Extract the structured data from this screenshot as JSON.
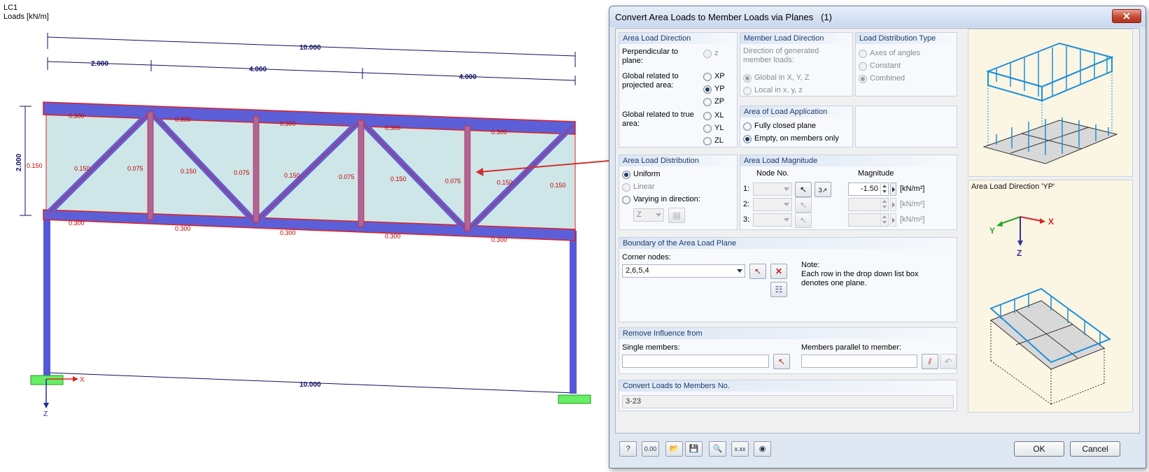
{
  "model": {
    "lc": "LC1",
    "units": "Loads [kN/m]",
    "dims": {
      "total_top": "10.000",
      "seg1": "2.000",
      "seg2": "4.000",
      "seg3": "4.000",
      "height": "2.000",
      "total_bottom": "10.000"
    },
    "load_values": {
      "chord": "0.300",
      "diag": "0.150",
      "post": "0.075"
    },
    "axes": {
      "x": "X",
      "z": "Z"
    }
  },
  "dialog": {
    "title": "Convert Area Loads to Member Loads via Planes",
    "title_count": "(1)",
    "close_label": "✕",
    "area_load_direction": {
      "title": "Area Load Direction",
      "perp_label": "Perpendicular to plane:",
      "perp_option": "z",
      "projected_label": "Global related to projected area:",
      "projected_options": [
        "XP",
        "YP",
        "ZP"
      ],
      "true_label": "Global related to true area:",
      "true_options": [
        "XL",
        "YL",
        "ZL"
      ]
    },
    "member_load_direction": {
      "title": "Member Load Direction",
      "desc": "Direction of generated member loads:",
      "options": [
        "Global in X, Y, Z",
        "Local in x, y, z"
      ]
    },
    "load_distribution_type": {
      "title": "Load Distribution Type",
      "options": [
        "Axes of angles",
        "Constant",
        "Combined"
      ]
    },
    "area_of_load_application": {
      "title": "Area of Load Application",
      "options": [
        "Fully closed plane",
        "Empty, on members only"
      ]
    },
    "area_load_distribution": {
      "title": "Area Load Distribution",
      "options": [
        "Uniform",
        "Linear",
        "Varying in direction:"
      ],
      "direction_value": "Z"
    },
    "area_load_magnitude": {
      "title": "Area Load Magnitude",
      "col_node": "Node No.",
      "col_magnitude": "Magnitude",
      "rows": [
        {
          "label": "1:",
          "magnitude": "-1.50",
          "unit": "[kN/m²]"
        },
        {
          "label": "2:",
          "magnitude": "",
          "unit": "[kN/m²]"
        },
        {
          "label": "3:",
          "magnitude": "",
          "unit": "[kN/m²]"
        }
      ]
    },
    "boundary": {
      "title": "Boundary of the Area Load Plane",
      "corner_label": "Corner nodes:",
      "corner_value": "2,6,5,4",
      "note_title": "Note:",
      "note_text_1": "Each row in the drop down list box",
      "note_text_2": "denotes one plane."
    },
    "remove_influence": {
      "title": "Remove Influence from",
      "single_label": "Single members:",
      "single_value": "",
      "parallel_label": "Members parallel to member:",
      "parallel_value": ""
    },
    "convert_loads": {
      "title": "Convert Loads to Members No.",
      "value": "3-23"
    },
    "preview_caption": "Area Load Direction 'YP'",
    "preview_axes": {
      "x": "X",
      "y": "Y",
      "z": "Z"
    },
    "buttons": {
      "ok": "OK",
      "cancel": "Cancel"
    },
    "footer_icons": [
      "help-icon",
      "units-icon",
      "open-icon",
      "save-icon",
      "view-icon",
      "decimal-icon",
      "visibility-icon"
    ],
    "footer_labels": {
      "units": "0.00",
      "decimals": "x.xx"
    }
  }
}
